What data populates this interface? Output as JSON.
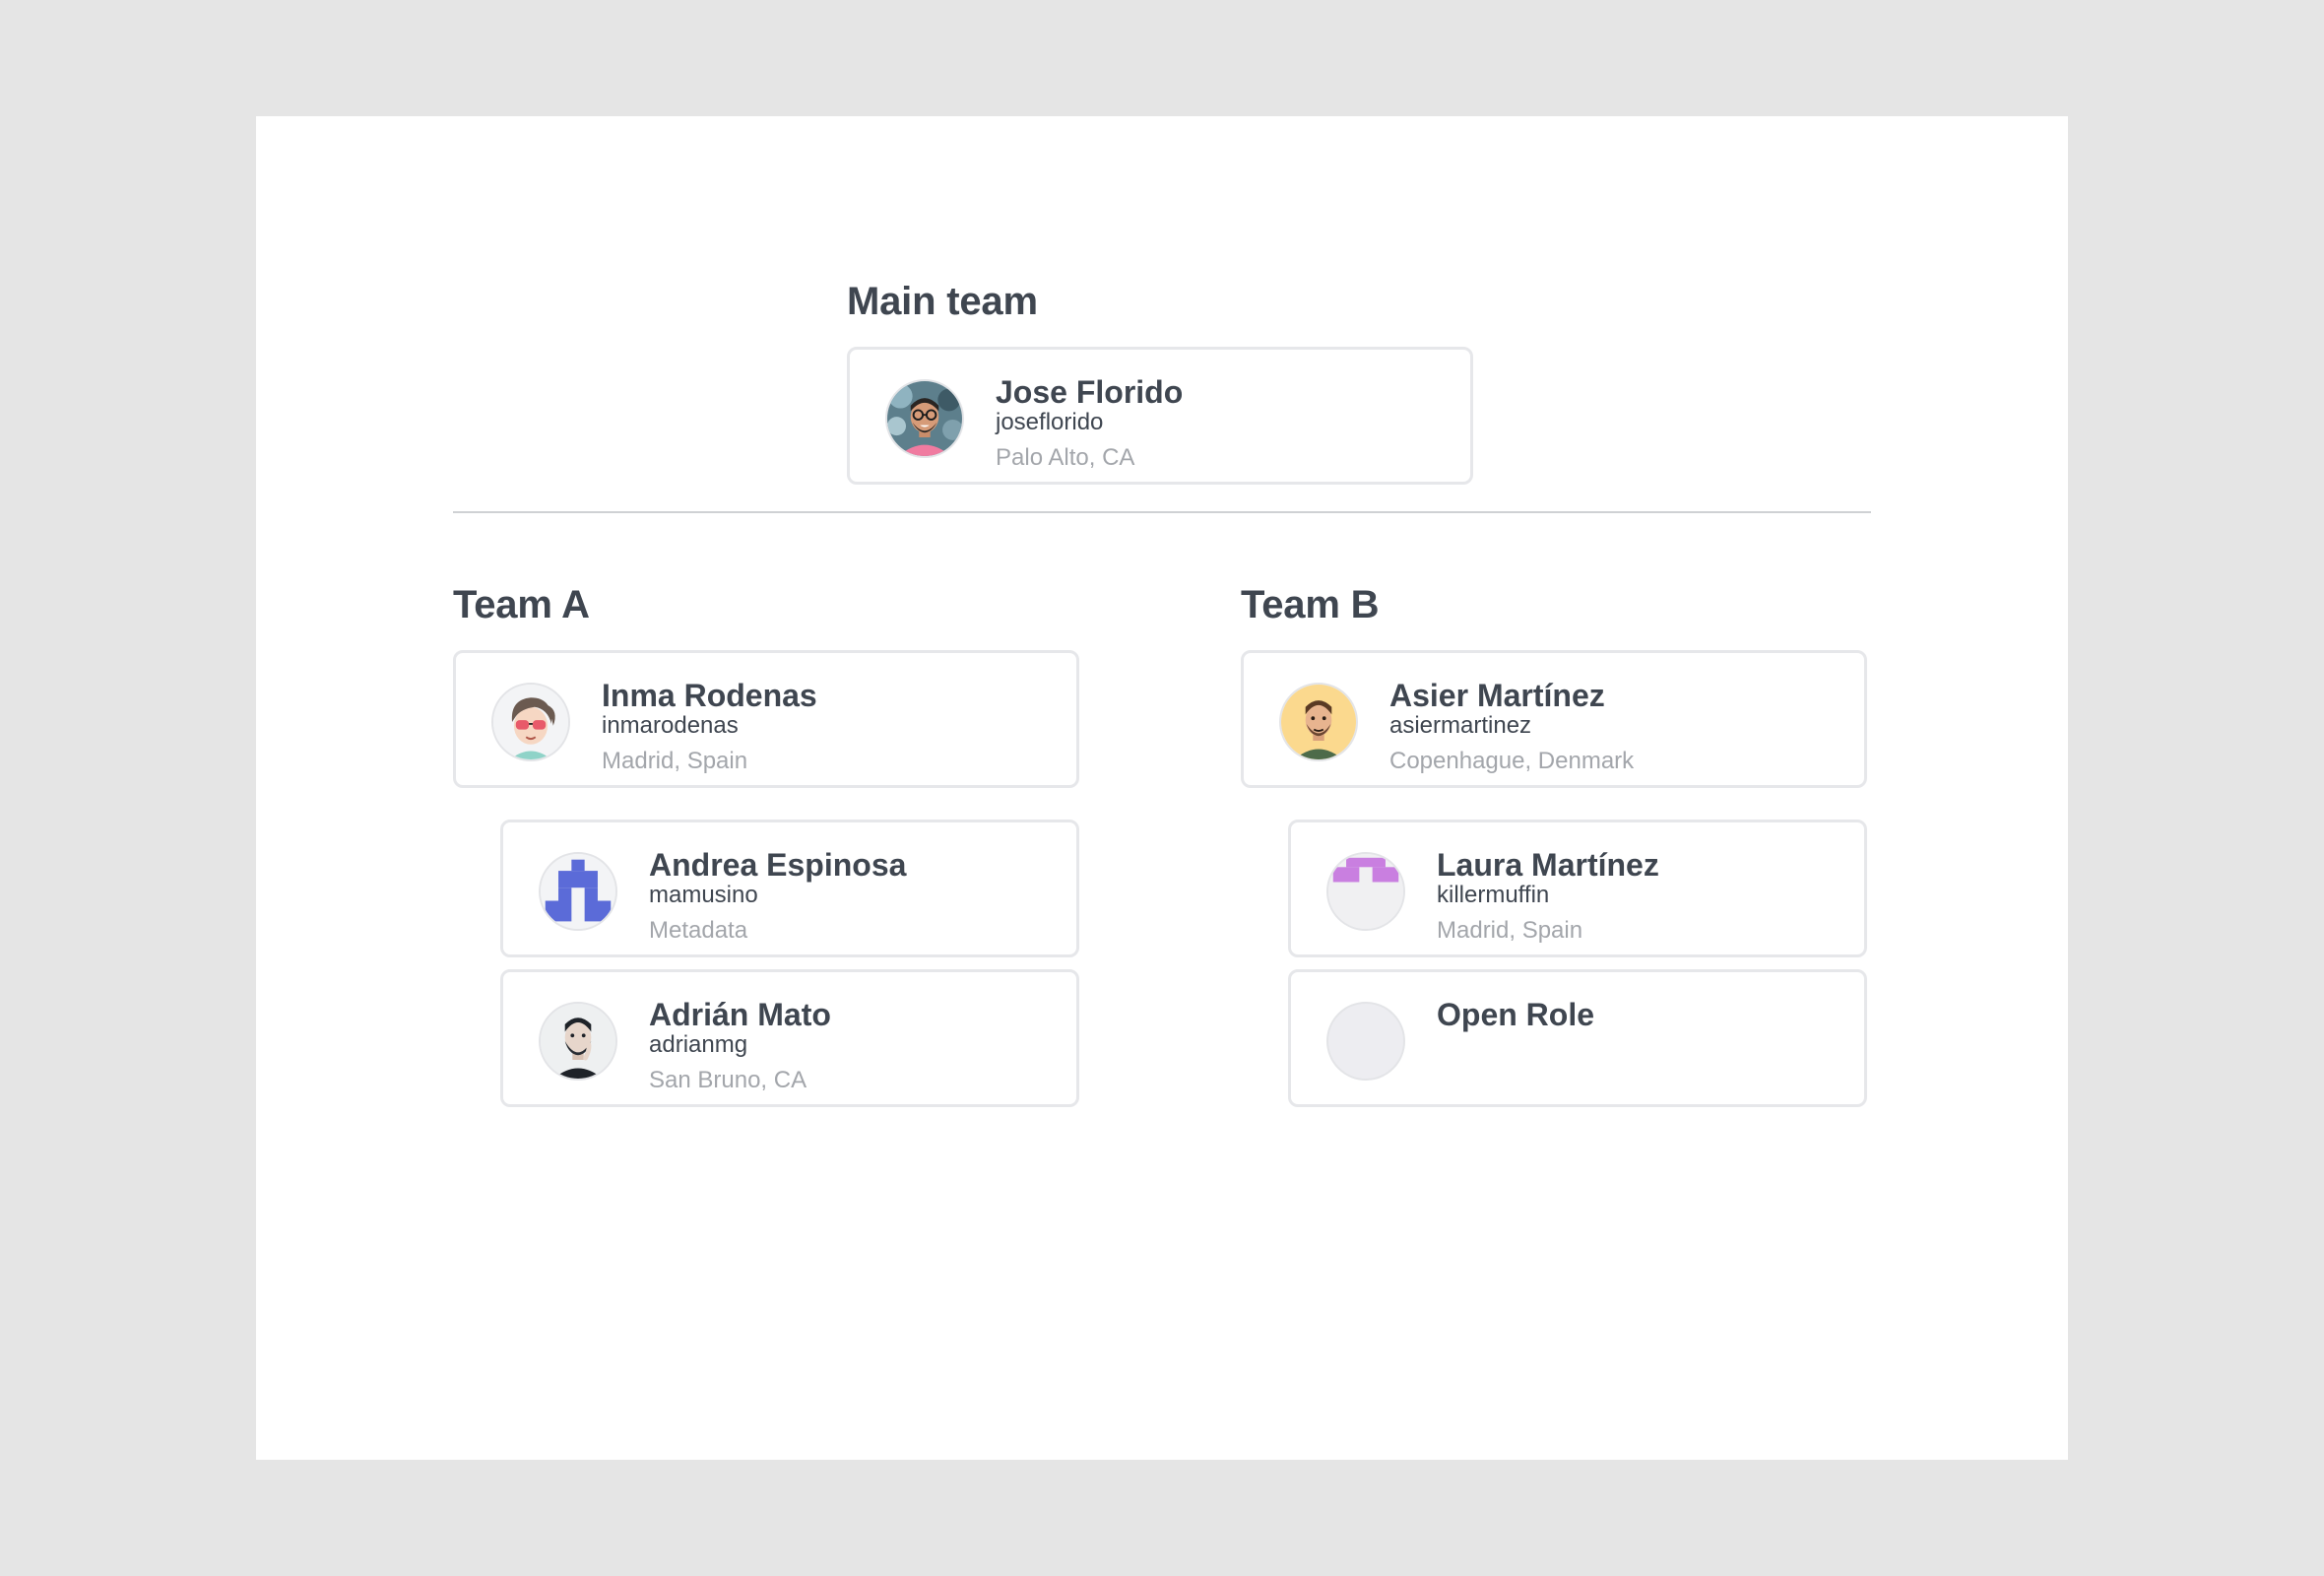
{
  "main_team": {
    "title": "Main team",
    "lead": {
      "name": "Jose Florido",
      "username": "joseflorido",
      "location": "Palo Alto, CA"
    }
  },
  "team_a": {
    "title": "Team A",
    "lead": {
      "name": "Inma Rodenas",
      "username": "inmarodenas",
      "location": "Madrid, Spain"
    },
    "members": [
      {
        "name": "Andrea Espinosa",
        "username": "mamusino",
        "location": "Metadata"
      },
      {
        "name": "Adrián Mato",
        "username": "adrianmg",
        "location": "San Bruno, CA"
      }
    ]
  },
  "team_b": {
    "title": "Team B",
    "lead": {
      "name": "Asier Martínez",
      "username": "asiermartinez",
      "location": "Copenhague, Denmark"
    },
    "members": [
      {
        "name": "Laura Martínez",
        "username": "killermuffin",
        "location": "Madrid, Spain"
      },
      {
        "name": "Open Role",
        "username": "",
        "location": ""
      }
    ]
  },
  "colors": {
    "page_background": "#e5e5e5",
    "canvas": "#ffffff",
    "text_primary": "#3f4650",
    "text_muted": "#a3a6ab",
    "card_border": "#e6e7ea",
    "divider": "#cfd1d4",
    "identicon_blue": "#5b6bd8",
    "identicon_purple": "#c97fe0"
  },
  "icons": {
    "jose_avatar": "avatar-photo-icon",
    "inma_avatar": "avatar-cartoon-icon",
    "andrea_avatar": "identicon-blue-icon",
    "adrian_avatar": "avatar-sketch-icon",
    "asier_avatar": "avatar-cartoon-icon",
    "laura_avatar": "identicon-purple-icon",
    "open_role_avatar": "empty-avatar-icon"
  }
}
